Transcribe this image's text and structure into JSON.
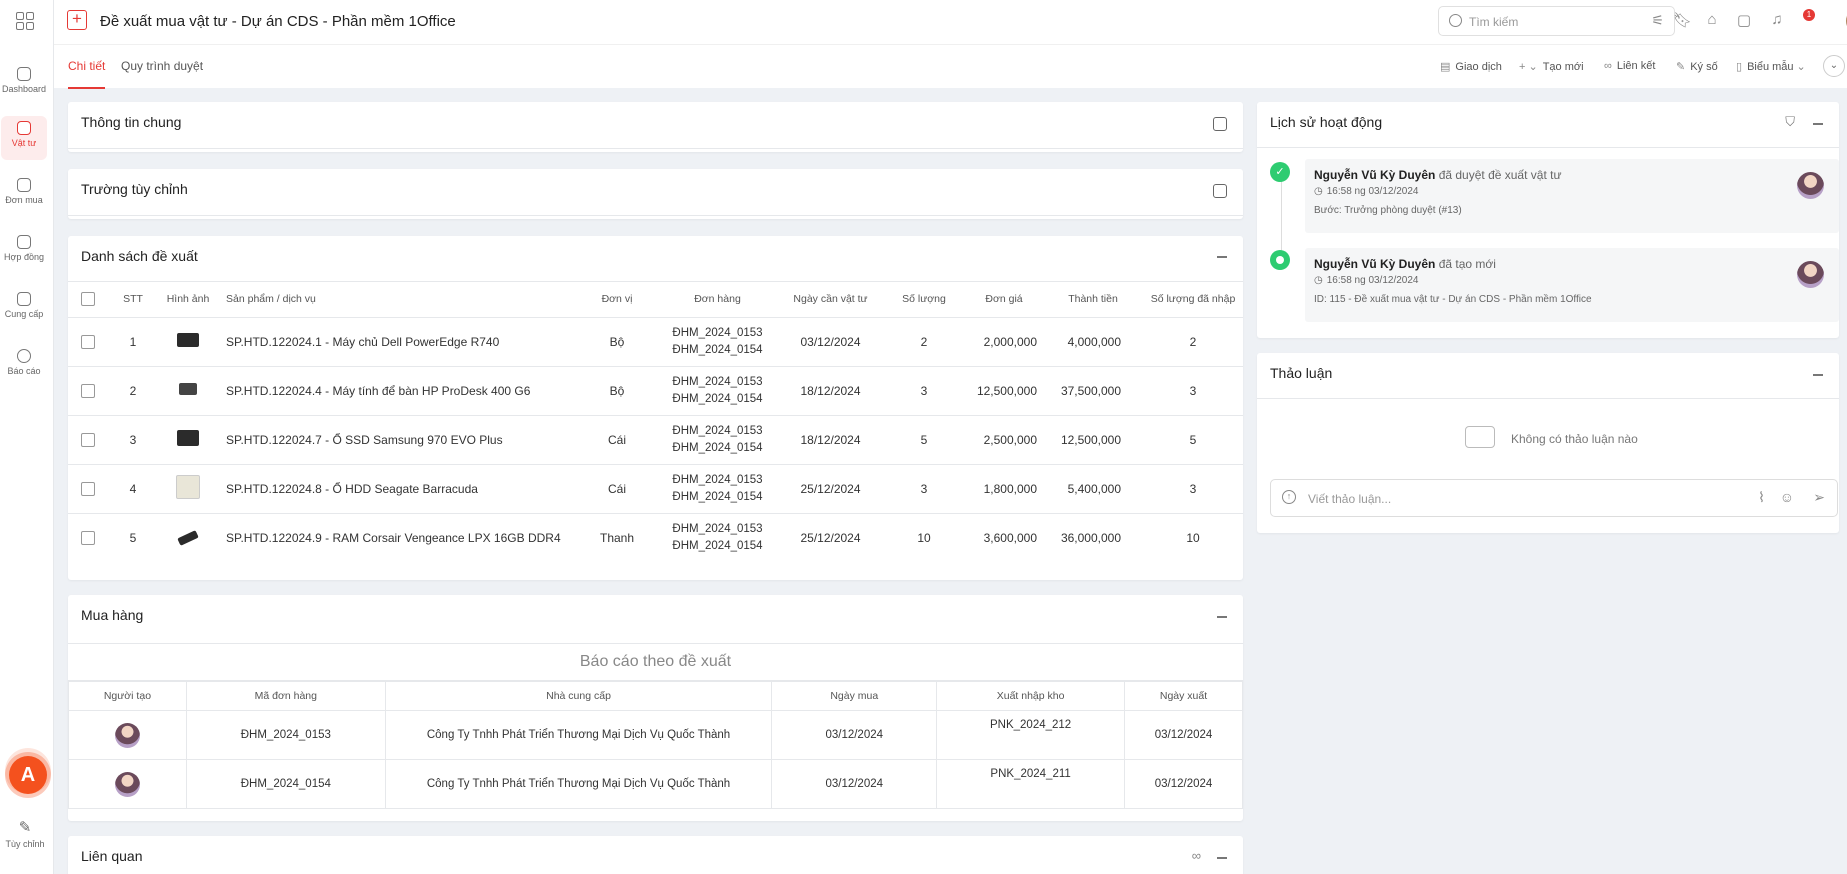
{
  "app": {
    "title": "Đề xuất mua vật tư - Dự án CDS - Phần mềm 1Office",
    "add_symbol": "+"
  },
  "sidebar": {
    "items": [
      {
        "label": "Dashboard",
        "icon": "dashboard-icon"
      },
      {
        "label": "Vật tư",
        "icon": "supplies-icon",
        "active": true
      },
      {
        "label": "Đơn mua",
        "icon": "purchase-order-icon"
      },
      {
        "label": "Hợp đồng",
        "icon": "contract-icon"
      },
      {
        "label": "Cung cấp",
        "icon": "truck-icon"
      },
      {
        "label": "Báo cáo",
        "icon": "report-icon"
      }
    ],
    "customize_label": "Tùy chỉnh",
    "logo_letter": "A"
  },
  "topbar": {
    "search_placeholder": "Tìm kiếm",
    "notification_count": "1"
  },
  "tabs": {
    "items": [
      "Chi tiết",
      "Quy trình duyệt"
    ],
    "active": "Chi tiết"
  },
  "actions": {
    "items": [
      "Giao dịch",
      "Tạo mới",
      "Liên kết",
      "Ký số",
      "Biểu mẫu"
    ]
  },
  "sections": {
    "general": "Thông tin chung",
    "custom_fields": "Trường tùy chỉnh",
    "proposal_list": "Danh sách đề xuất",
    "purchasing": "Mua hàng",
    "related": "Liên quan"
  },
  "proposals": {
    "headers": [
      "STT",
      "Hình ảnh",
      "Sản phẩm / dịch vụ",
      "Đơn vị",
      "Đơn hàng",
      "Ngày cần vật tư",
      "Số lượng",
      "Đơn giá",
      "Thành tiền",
      "Số lượng đã nhập"
    ],
    "rows": [
      {
        "stt": "1",
        "product": "SP.HTD.122024.1 - Máy chủ Dell PowerEdge R740",
        "unit": "Bộ",
        "orders": [
          "ĐHM_2024_0153",
          "ĐHM_2024_0154"
        ],
        "date": "03/12/2024",
        "qty": "2",
        "price": "2,000,000",
        "total": "4,000,000",
        "received": "2"
      },
      {
        "stt": "2",
        "product": "SP.HTD.122024.4 - Máy tính để bàn HP ProDesk 400 G6",
        "unit": "Bộ",
        "orders": [
          "ĐHM_2024_0153",
          "ĐHM_2024_0154"
        ],
        "date": "18/12/2024",
        "qty": "3",
        "price": "12,500,000",
        "total": "37,500,000",
        "received": "3"
      },
      {
        "stt": "3",
        "product": "SP.HTD.122024.7 - Ổ SSD Samsung 970 EVO Plus",
        "unit": "Cái",
        "orders": [
          "ĐHM_2024_0153",
          "ĐHM_2024_0154"
        ],
        "date": "18/12/2024",
        "qty": "5",
        "price": "2,500,000",
        "total": "12,500,000",
        "received": "5"
      },
      {
        "stt": "4",
        "product": "SP.HTD.122024.8 - Ổ HDD Seagate Barracuda",
        "unit": "Cái",
        "orders": [
          "ĐHM_2024_0153",
          "ĐHM_2024_0154"
        ],
        "date": "25/12/2024",
        "qty": "3",
        "price": "1,800,000",
        "total": "5,400,000",
        "received": "3"
      },
      {
        "stt": "5",
        "product": "SP.HTD.122024.9 - RAM Corsair Vengeance LPX 16GB DDR4",
        "unit": "Thanh",
        "orders": [
          "ĐHM_2024_0153",
          "ĐHM_2024_0154"
        ],
        "date": "25/12/2024",
        "qty": "10",
        "price": "3,600,000",
        "total": "36,000,000",
        "received": "10"
      }
    ]
  },
  "purchasing": {
    "report_title": "Báo cáo theo đề xuất",
    "headers": [
      "Người tạo",
      "Mã đơn hàng",
      "Nhà cung cấp",
      "Ngày mua",
      "Xuất nhập kho",
      "Ngày xuất"
    ],
    "rows": [
      {
        "order": "ĐHM_2024_0153",
        "supplier": "Công Ty Tnhh Phát Triển Thương Mại Dịch Vụ Quốc Thành",
        "buy_date": "03/12/2024",
        "warehouse": "PNK_2024_212",
        "export_date": "03/12/2024"
      },
      {
        "order": "ĐHM_2024_0154",
        "supplier": "Công Ty Tnhh Phát Triển Thương Mại Dịch Vụ Quốc Thành",
        "buy_date": "03/12/2024",
        "warehouse": "PNK_2024_211",
        "export_date": "03/12/2024"
      }
    ]
  },
  "history": {
    "title": "Lịch sử hoạt động",
    "items": [
      {
        "user": "Nguyễn Vũ Kỳ Duyên",
        "action": "đã duyệt đề xuất vật tư",
        "time": "16:58 ng 03/12/2024",
        "detail": "Bước: Trưởng phòng duyệt (#13)"
      },
      {
        "user": "Nguyễn Vũ Kỳ Duyên",
        "action": "đã tạo mới",
        "time": "16:58 ng 03/12/2024",
        "detail": "ID: 115 - Đề xuất mua vật tư - Dự án CDS - Phần mềm 1Office"
      }
    ]
  },
  "discussion": {
    "title": "Thảo luận",
    "empty_text": "Không có thảo luận nào",
    "input_placeholder": "Viết thảo luận..."
  }
}
